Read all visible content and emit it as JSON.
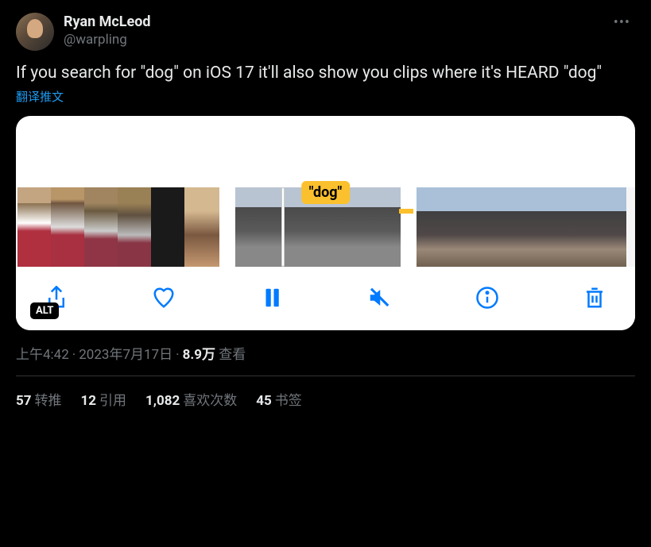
{
  "user": {
    "display_name": "Ryan McLeod",
    "handle": "@warpling"
  },
  "tweet": {
    "text": "If you search for \"dog\" on iOS 17 it'll also show you clips where it's HEARD \"dog\"",
    "translate_label": "翻译推文"
  },
  "media": {
    "caption": "\"dog\"",
    "alt_badge": "ALT"
  },
  "meta": {
    "time": "上午4:42",
    "date": "2023年7月17日",
    "views_count": "8.9万",
    "views_label": "查看"
  },
  "stats": {
    "retweets_count": "57",
    "retweets_label": "转推",
    "quotes_count": "12",
    "quotes_label": "引用",
    "likes_count": "1,082",
    "likes_label": "喜欢次数",
    "bookmarks_count": "45",
    "bookmarks_label": "书签"
  }
}
